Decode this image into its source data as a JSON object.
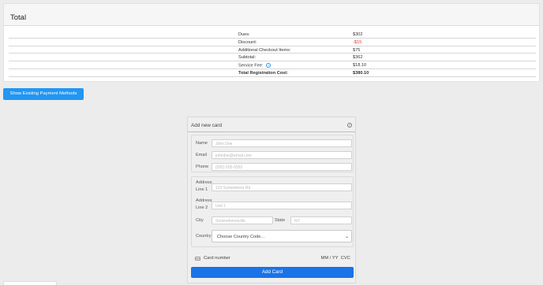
{
  "total": {
    "title": "Total",
    "rows": [
      {
        "label": "Dues:",
        "value": "$302"
      },
      {
        "label": "Discount:",
        "value": "-$15"
      },
      {
        "label": "Additional Checkout Items:",
        "value": "$75"
      },
      {
        "label": "Subtotal:",
        "value": "$362"
      },
      {
        "label": "Service Fee:",
        "value": "$18.10"
      },
      {
        "label": "Total Registration Cost:",
        "value": "$380.10"
      }
    ],
    "info_glyph": "i",
    "negative_color": "#e0312b"
  },
  "actions": {
    "show_methods_label": "Show Existing Payment Methods"
  },
  "card_form": {
    "title": "Add new card",
    "close_glyph": "×",
    "name": {
      "label": "Name",
      "placeholder": "John Doe"
    },
    "email": {
      "label": "Email",
      "placeholder": "johndoe@email.com"
    },
    "phone": {
      "label": "Phone",
      "placeholder": "(555) 555-5555"
    },
    "address1": {
      "label_1": "Address",
      "label_2": "Line 1",
      "placeholder": "123 Somewhere Rd"
    },
    "address2": {
      "label_1": "Address",
      "label_2": "Line 2",
      "placeholder": "Unit 1"
    },
    "city": {
      "label": "City",
      "placeholder": "Somewheresville"
    },
    "state": {
      "label": "State",
      "placeholder": "NY"
    },
    "country": {
      "label": "Country",
      "selected": "Choose Country Code...",
      "chevron": "⌄"
    },
    "card": {
      "number_placeholder": "Card number",
      "expiry_cvc": "MM / YY  CVC"
    },
    "submit_label": "Add Card"
  },
  "colors": {
    "primary": "#2196f3",
    "submit": "#1a73e8"
  }
}
